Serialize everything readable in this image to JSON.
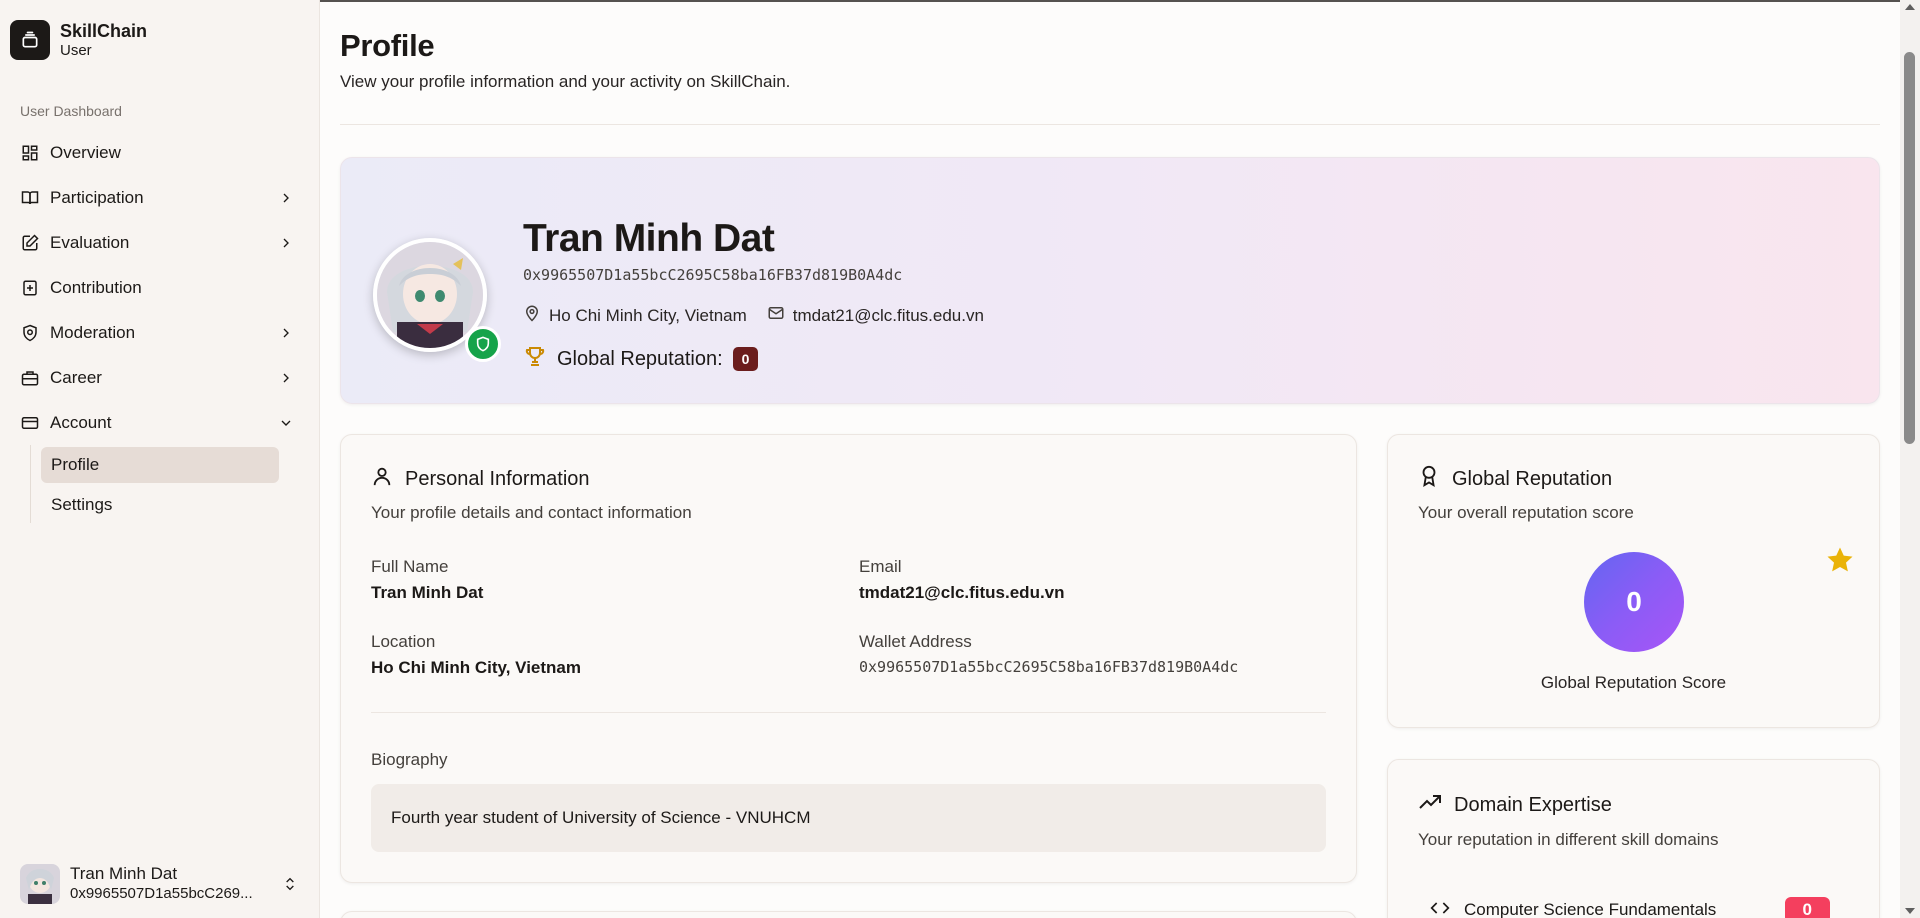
{
  "brand": {
    "title": "SkillChain",
    "subtitle": "User"
  },
  "sidebar": {
    "section_label": "User Dashboard",
    "items": [
      {
        "label": "Overview",
        "icon": "grid-icon",
        "has_chevron": false
      },
      {
        "label": "Participation",
        "icon": "book-open-icon",
        "has_chevron": true
      },
      {
        "label": "Evaluation",
        "icon": "edit-icon",
        "has_chevron": true
      },
      {
        "label": "Contribution",
        "icon": "file-plus-icon",
        "has_chevron": false
      },
      {
        "label": "Moderation",
        "icon": "shield-check-icon",
        "has_chevron": true
      },
      {
        "label": "Career",
        "icon": "briefcase-icon",
        "has_chevron": true
      },
      {
        "label": "Account",
        "icon": "credit-card-icon",
        "has_chevron": true,
        "expanded": true
      }
    ],
    "account_sub": [
      {
        "label": "Profile",
        "active": true
      },
      {
        "label": "Settings",
        "active": false
      }
    ],
    "user": {
      "name": "Tran Minh Dat",
      "address_short": "0x9965507D1a55bcC269..."
    }
  },
  "page": {
    "title": "Profile",
    "subtitle": "View your profile information and your activity on SkillChain."
  },
  "hero": {
    "name": "Tran Minh Dat",
    "wallet": "0x9965507D1a55bcC2695C58ba16FB37d819B0A4dc",
    "location": "Ho Chi Minh City, Vietnam",
    "email": "tmdat21@clc.fitus.edu.vn",
    "reputation_label": "Global Reputation:",
    "reputation_value": "0"
  },
  "personal": {
    "title": "Personal Information",
    "description": "Your profile details and contact information",
    "full_name_label": "Full Name",
    "full_name": "Tran Minh Dat",
    "email_label": "Email",
    "email": "tmdat21@clc.fitus.edu.vn",
    "location_label": "Location",
    "location": "Ho Chi Minh City, Vietnam",
    "wallet_label": "Wallet Address",
    "wallet": "0x9965507D1a55bcC2695C58ba16FB37d819B0A4dc",
    "bio_label": "Biography",
    "bio": "Fourth year student of University of Science - VNUHCM"
  },
  "global_reputation": {
    "title": "Global Reputation",
    "description": "Your overall reputation score",
    "score": "0",
    "score_label": "Global Reputation Score"
  },
  "domain_expertise": {
    "title": "Domain Expertise",
    "description": "Your reputation in different skill domains",
    "domains": [
      {
        "name": "Computer Science Fundamentals",
        "score": "0"
      }
    ]
  },
  "colors": {
    "accent_dark": "#1c1917",
    "badge_maroon": "#6b1d1d",
    "shield_green": "#16a34a",
    "score_gradient_start": "#6366f1",
    "score_gradient_end": "#a855f7",
    "domain_badge": "#f43f5e",
    "star": "#eab308",
    "trophy": "#ca8a04"
  }
}
